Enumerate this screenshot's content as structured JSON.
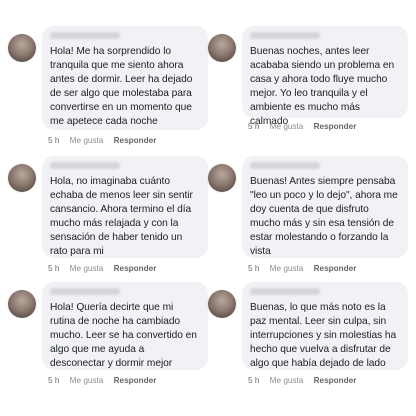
{
  "comments": [
    {
      "text": "Hola! Me ha sorprendido lo tranquila que me siento ahora antes de dormir. Leer ha dejado de ser algo que molestaba para convertirse en un momento que me apetece cada noche",
      "time": "5 h",
      "like": "Me gusta",
      "reply": "Responder"
    },
    {
      "text": "Buenas noches, antes leer acababa siendo un problema en casa y ahora todo fluye mucho mejor. Yo leo tranquila y el ambiente es mucho más calmado",
      "time": "5 h",
      "like": "Me gusta",
      "reply": "Responder"
    },
    {
      "text": "Hola, no imaginaba cuánto echaba de menos leer sin sentir cansancio. Ahora termino el día mucho más relajada y con la sensación de haber tenido un rato para mi",
      "time": "5 h",
      "like": "Me gusta",
      "reply": "Responder"
    },
    {
      "text": "Buenas! Antes siempre pensaba \"leo un poco y lo dejo\", ahora me doy cuenta de que disfruto mucho más y sin esa tensión de estar molestando o forzando la vista",
      "time": "5 h",
      "like": "Me gusta",
      "reply": "Responder"
    },
    {
      "text": "Hola! Quería decirte que mi rutina de noche ha cambiado mucho. Leer se ha convertido en algo que me ayuda a desconectar y dormir mejor",
      "time": "5 h",
      "like": "Me gusta",
      "reply": "Responder"
    },
    {
      "text": "Buenas, lo que más noto es la paz mental. Leer sin culpa, sin interrupciones y sin molestias ha hecho que vuelva a disfrutar de algo que había dejado de lado",
      "time": "5 h",
      "like": "Me gusta",
      "reply": "Responder"
    }
  ]
}
